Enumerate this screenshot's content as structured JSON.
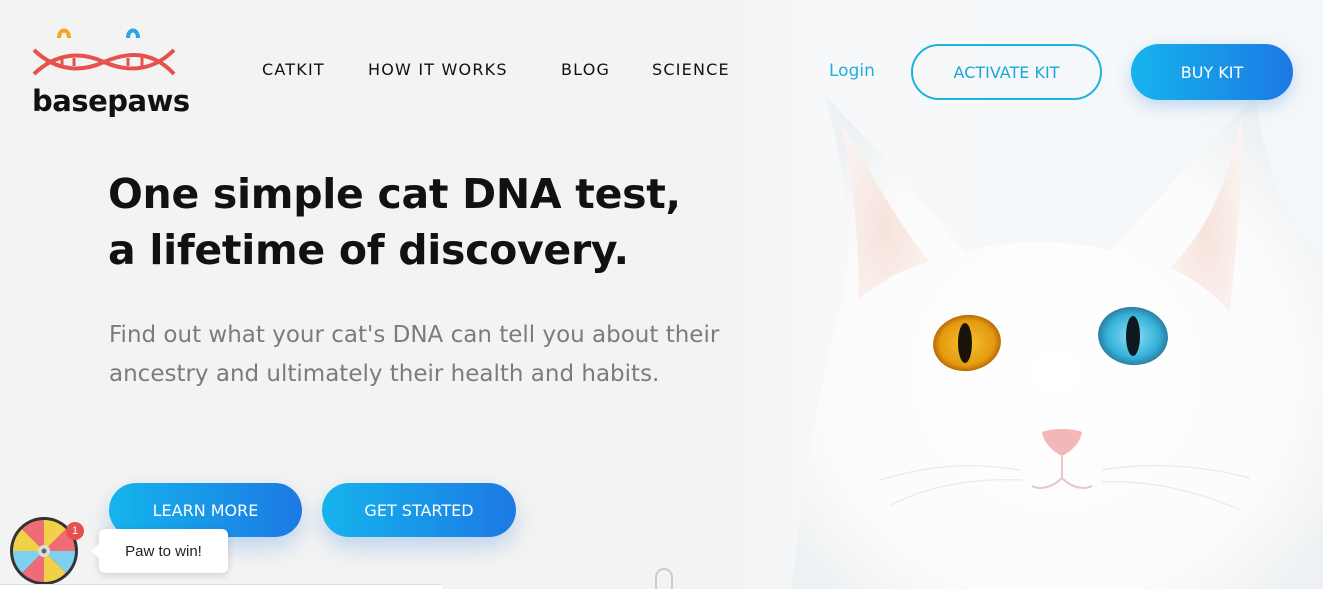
{
  "brand": {
    "name": "basepaws"
  },
  "nav": {
    "items": [
      {
        "label": "CATKIT"
      },
      {
        "label": "HOW IT WORKS"
      },
      {
        "label": "BLOG"
      },
      {
        "label": "SCIENCE"
      }
    ],
    "login_label": "Login",
    "activate_label": "ACTIVATE KIT",
    "buy_label": "BUY KIT"
  },
  "hero": {
    "headline_line1": "One simple cat DNA test,",
    "headline_line2": "a lifetime of discovery.",
    "subtext": "Find out what your cat's DNA can tell you about their ancestry and ultimately their health and habits.",
    "learn_more_label": "LEARN MORE",
    "get_started_label": "GET STARTED"
  },
  "widget": {
    "badge_count": "1",
    "bubble_text": "Paw to win!"
  },
  "colors": {
    "accent": "#1fb2dd",
    "gradient_start": "#15b4ec",
    "gradient_end": "#1c79e4",
    "logo_red": "#e8504b",
    "logo_orange": "#f5a623",
    "logo_blue": "#2aa7e0"
  },
  "icons": {
    "logo": "dna-double-helix-cat-icon",
    "wheel": "prize-wheel-icon"
  }
}
